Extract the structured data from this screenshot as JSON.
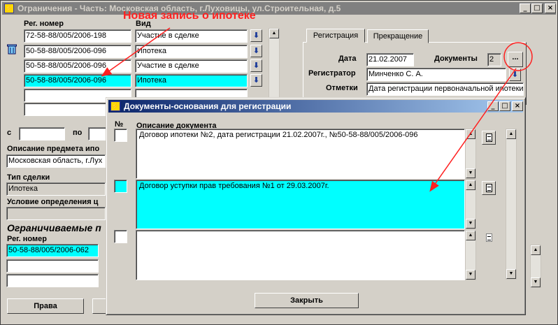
{
  "main_window": {
    "title": "Ограничения - Часть: Московская область, г.Луховицы, ул.Строительная, д.5",
    "minimize": "_",
    "maximize": "□",
    "close": "×"
  },
  "annotation": "Новая запись о ипотеке",
  "grid": {
    "col_reg": "Рег. номер",
    "col_kind": "Вид",
    "rows": [
      {
        "reg": "72-58-88/005/2006-198",
        "kind": "Участие в сделке"
      },
      {
        "reg": "50-58-88/005/2006-096",
        "kind": "Ипотека"
      },
      {
        "reg": "50-58-88/005/2006-096",
        "kind": "Участие в сделке"
      },
      {
        "reg": "50-58-88/005/2006-096",
        "kind": "Ипотека"
      },
      {
        "reg": "",
        "kind": ""
      },
      {
        "reg": "",
        "kind": ""
      }
    ]
  },
  "left_form": {
    "from_label": "с",
    "to_label": "по",
    "subject_label": "Описание предмета ипо",
    "subject_value": "Московская область, г.Лух",
    "deal_type_label": "Тип сделки",
    "deal_type_value": "Ипотека",
    "condition_label": "Условие определения ц",
    "restricted_label": "Ограничиваемые п",
    "reg_label": "Рег. номер",
    "reg_values": [
      "50-58-88/005/2006-062",
      "",
      ""
    ],
    "rights_button": "Права"
  },
  "registration": {
    "tab_reg": "Регистрация",
    "tab_stop": "Прекращение",
    "date_label": "Дата",
    "date_value": "21.02.2007",
    "docs_label": "Документы",
    "docs_count": "2",
    "docs_button": "...",
    "registrar_label": "Регистратор",
    "registrar_value": "Минченко С. А.",
    "notes_label": "Отметки",
    "notes_value": "Дата регистрации первоначальной ипотеки"
  },
  "dialog": {
    "title": "Документы-основания для регистрации",
    "col_no": "№",
    "col_desc": "Описание документа",
    "docs": [
      "Договор ипотеки №2, дата регистрации 21.02.2007г., №50-58-88/005/2006-096",
      "Договор уступки прав требования №1 от 29.03.2007г.",
      ""
    ],
    "close_button": "Закрыть"
  }
}
